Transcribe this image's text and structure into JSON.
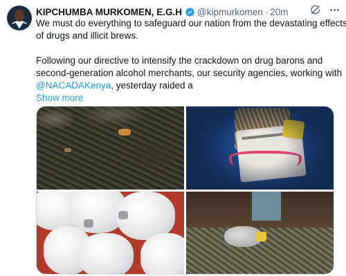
{
  "tweet": {
    "author_name": "KIPCHUMBA MURKOMEN, E.G.H",
    "handle": "@kipmurkomen",
    "separator": "·",
    "time": "20m",
    "text_lines": [
      "We must do everything to safeguard our nation from the devastating effects",
      "of drugs and illicit brews."
    ],
    "para2_lines": [
      "Following our directive to intensify the crackdown on drug barons and",
      "second-generation alcohol merchants, our security agencies, working with"
    ],
    "mention": "@NACADAKenya",
    "mention_suffix": ", yesterday raided a",
    "show_more": "Show more"
  },
  "icons": {
    "verified": "verified-badge-icon",
    "grok": "grok-icon",
    "more": "more-dots-icon"
  },
  "colors": {
    "accent": "#1d9bf0",
    "text": "#0f1419",
    "secondary": "#536471"
  },
  "media": {
    "image_count": 4
  }
}
